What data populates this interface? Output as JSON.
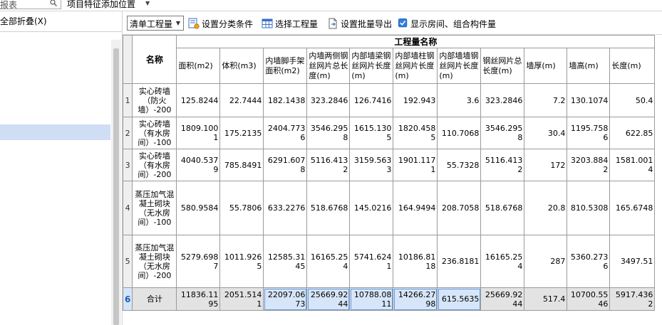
{
  "topbar": {
    "search_text": "报表",
    "combo_label": "项目特征添加位置"
  },
  "left_panel": {
    "collapse_all": "全部折叠(X)"
  },
  "toolbar": {
    "select_value": "清单工程量",
    "btn_classify": "设置分类条件",
    "btn_choose": "选择工程量",
    "btn_export": "设置批量导出",
    "chk_show": "显示房间、组合构件量",
    "chk_checked": true
  },
  "table": {
    "name_header": "名称",
    "group_header": "工程量名称",
    "columns": [
      "面积(m2)",
      "体积(m3)",
      "内墙脚手架面积(m2)",
      "内墙两侧钢丝网片总长度(m)",
      "内部墙梁钢丝网片长度(m)",
      "内部墙柱钢丝网片长度(m)",
      "内部墙墙钢丝网片长度(m)",
      "钢丝网片总长度(m)",
      "墙厚(m)",
      "墙高(m)",
      "长度(m)"
    ],
    "rows": [
      {
        "no": "1",
        "name": "实心砖墙（防火墙）-200",
        "values": [
          "125.8244",
          "22.7444",
          "182.1438",
          "323.2846",
          "126.7416",
          "192.943",
          "3.6",
          "323.2846",
          "7.2",
          "130.1074",
          "50.4"
        ]
      },
      {
        "no": "2",
        "name": "实心砖墙（有水房间）-100",
        "values": [
          "1809.1001",
          "175.2135",
          "2404.7736",
          "3546.2958",
          "1615.1305",
          "1820.4585",
          "110.7068",
          "3546.2958",
          "30.4",
          "1195.7586",
          "622.85"
        ]
      },
      {
        "no": "3",
        "name": "实心砖墙（有水房间）-200",
        "values": [
          "4040.5379",
          "785.8491",
          "6291.6078",
          "5116.4132",
          "3159.5633",
          "1901.1171",
          "55.7328",
          "5116.4132",
          "172",
          "3203.8842",
          "1581.0014"
        ]
      },
      {
        "no": "4",
        "name": "蒸压加气混凝土砌块（无水房间）-100",
        "values": [
          "580.9584",
          "55.7806",
          "633.2276",
          "518.6768",
          "145.0216",
          "164.9494",
          "208.7058",
          "518.6768",
          "20.8",
          "810.5308",
          "165.6748"
        ]
      },
      {
        "no": "5",
        "name": "蒸压加气混凝土砌块（无水房间）-200",
        "values": [
          "5279.6987",
          "1011.9265",
          "12585.3145",
          "16165.254",
          "5741.6241",
          "10186.8118",
          "236.8181",
          "16165.254",
          "287",
          "5360.2736",
          "3497.51"
        ]
      }
    ],
    "total": {
      "no": "6",
      "name": "合计",
      "values": [
        "11836.1195",
        "2051.5141",
        "22097.0673",
        "25669.9244",
        "10788.0811",
        "14266.2798",
        "615.5635",
        "25669.9244",
        "517.4",
        "10700.5546",
        "5917.4362"
      ]
    }
  },
  "colors": {
    "selection": "#d6e5f8",
    "left_selected": "#cfdef5",
    "total_row_bg": "#e3e3e3"
  }
}
